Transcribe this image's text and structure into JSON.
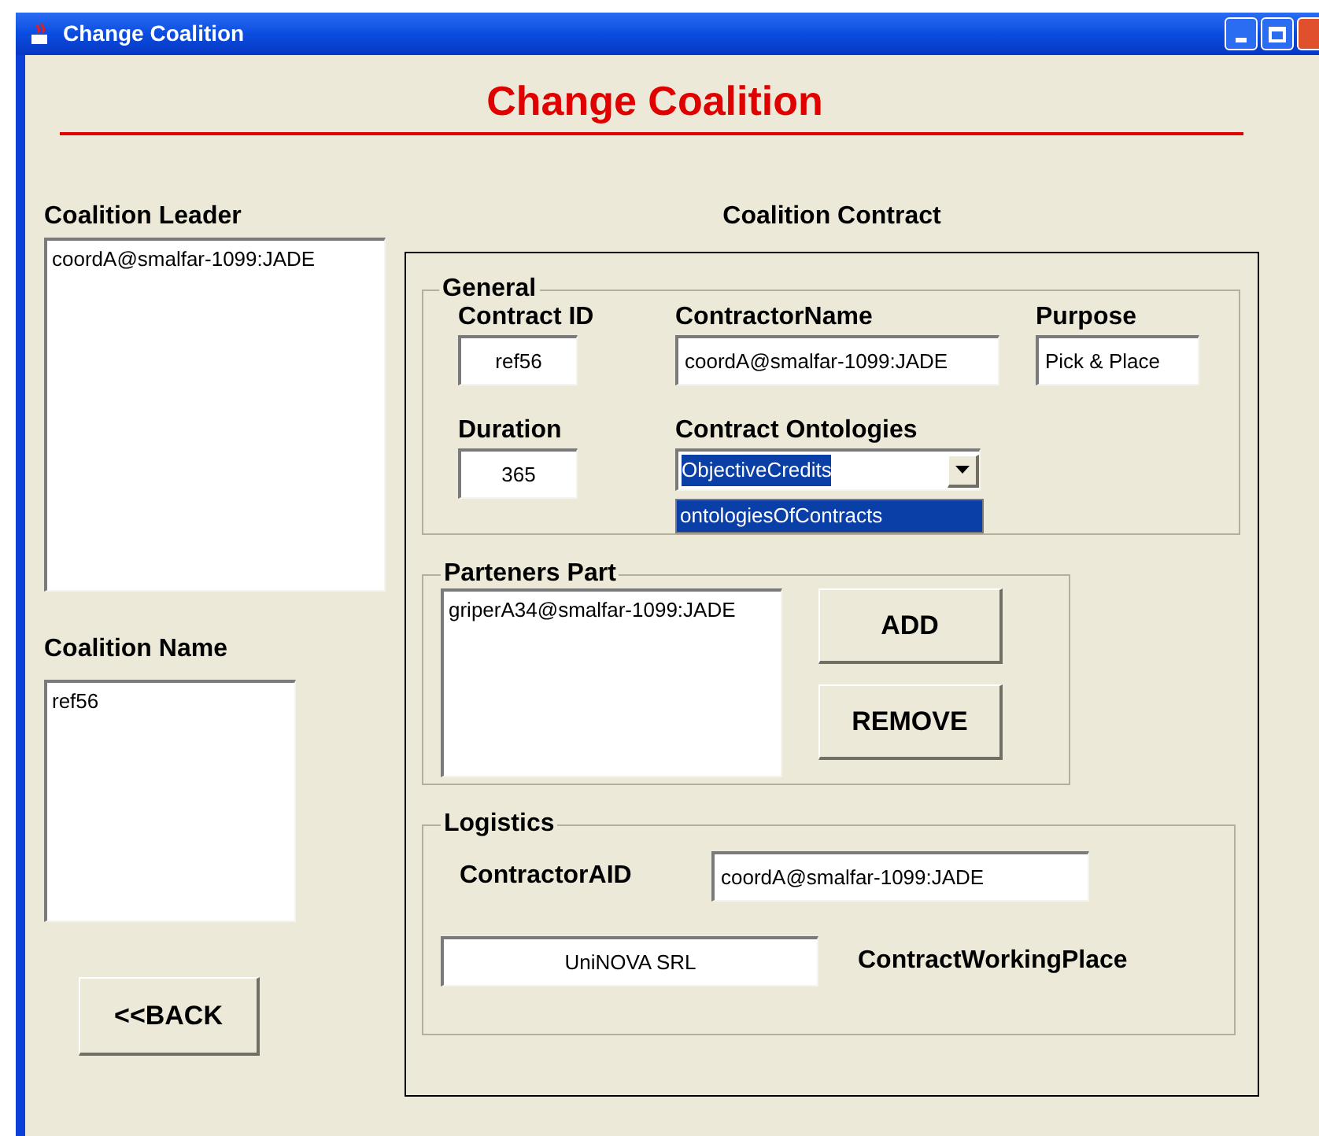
{
  "window": {
    "title": "Change Coalition"
  },
  "heading": "Change Coalition",
  "coalition_leader": {
    "label": "Coalition Leader",
    "items": [
      "coordA@smalfar-1099:JADE"
    ]
  },
  "coalition_name": {
    "label": "Coalition Name",
    "items": [
      "ref56"
    ]
  },
  "back_button": "<<BACK",
  "contract": {
    "title": "Coalition Contract",
    "general": {
      "title": "General",
      "contract_id": {
        "label": "Contract ID",
        "value": "ref56"
      },
      "contractor_name": {
        "label": "ContractorName",
        "value": "coordA@smalfar-1099:JADE"
      },
      "purpose": {
        "label": "Purpose",
        "value": "Pick & Place"
      },
      "duration": {
        "label": "Duration",
        "value": "365"
      },
      "ontologies": {
        "label": "Contract Ontologies",
        "value": "ObjectiveCredits",
        "value_selected": true,
        "options": [
          {
            "label": "ontologiesOfContracts",
            "selected": true
          }
        ]
      }
    },
    "partners": {
      "title": "Parteners Part",
      "items": [
        "griperA34@smalfar-1099:JADE"
      ],
      "buttons": [
        "ADD",
        "REMOVE"
      ]
    },
    "logistics": {
      "title": "Logistics",
      "contractor_aid": {
        "label": "ContractorAID",
        "value": "coordA@smalfar-1099:JADE"
      },
      "working_place": {
        "label": "ContractWorkingPlace",
        "value": "UniNOVA SRL"
      }
    }
  }
}
